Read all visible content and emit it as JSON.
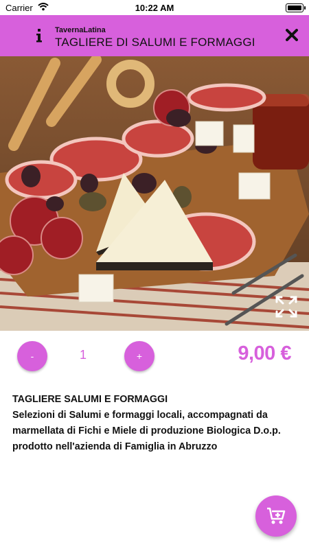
{
  "status_bar": {
    "carrier": "Carrier",
    "time": "10:22 AM"
  },
  "header": {
    "subtitle": "TavernaLatina",
    "title": "TAGLIERE DI SALUMI E FORMAGGI",
    "info_icon": "info-icon",
    "close_icon": "close-icon"
  },
  "product": {
    "image_icon": "expand-icon",
    "quantity": "1",
    "minus_label": "-",
    "plus_label": "+",
    "price": "9,00 €",
    "name": "TAGLIERE SALUMI E FORMAGGI",
    "description": "Selezioni di Salumi e formaggi locali, accompagnati da marmellata di Fichi e Miele di produzione Biologica D.o.p. prodotto nell'azienda di Famiglia in Abruzzo"
  },
  "fab": {
    "icon": "add-to-cart-icon"
  },
  "colors": {
    "accent": "#d760dc"
  }
}
